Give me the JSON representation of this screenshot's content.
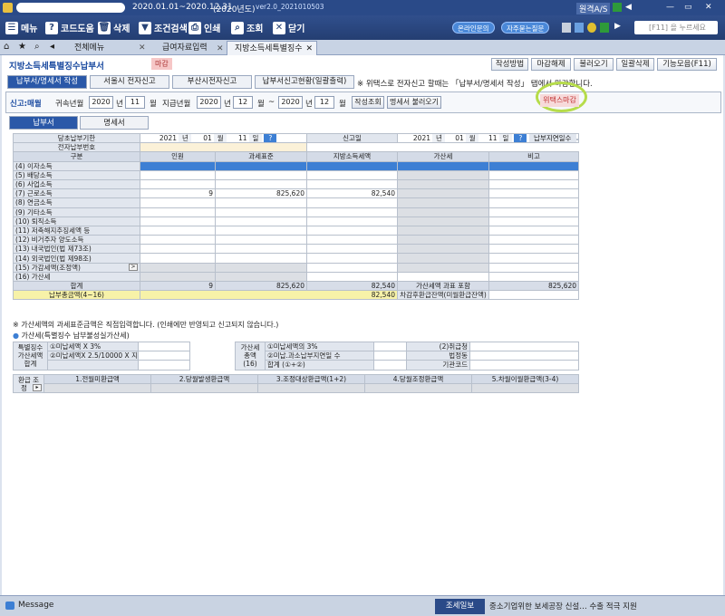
{
  "titlebar": {
    "period": "2020.01.01~2020.12.31",
    "year": "(2020년도)",
    "version": "ver2.0_2021010503",
    "right": "원격A/S"
  },
  "toolbar": {
    "menu": "메뉴",
    "code": "코드도움",
    "delete": "삭제",
    "filter": "조건검색",
    "print": "인쇄",
    "query": "조회",
    "close": "닫기",
    "online": "온라인문의",
    "faq": "자주묻는질문",
    "search_placeholder": "[F11] 을 누르세요"
  },
  "tabs": {
    "t1": "전체메뉴",
    "t2": "급여자료입력",
    "t3": "지방소득세특별징수"
  },
  "page": {
    "title": "지방소득세특별징수납부서",
    "badge": "마감",
    "buttons": [
      "작성방법",
      "마감해제",
      "불러오기",
      "일괄삭제",
      "기능모음(F11)"
    ],
    "subtabs": [
      "납부서/명세서 작성",
      "서울시 전자신고",
      "부산시전자신고",
      "납부서신고현황(일괄출력)"
    ],
    "note": "※ 위택스로 전자신고 할때는 「납부서/명세서 작성」 탭에서 마감합니다.",
    "wetax_magam": "위택스마감"
  },
  "filter": {
    "type_label": "신고:매월",
    "attr_label": "귀속년월",
    "attr_year": "2020",
    "attr_month": "11",
    "year_unit": "년",
    "month_unit": "월",
    "pay_label": "지급년월",
    "pay_from_year": "2020",
    "pay_from_month": "12",
    "pay_to_year": "2020",
    "pay_to_month": "12",
    "tilde": "~",
    "btn1": "작성조회",
    "btn2": "명세서 불러오기"
  },
  "btabs": [
    "납부서",
    "명세서"
  ],
  "form": {
    "due_label": "당초납부기한",
    "due_y": "2021",
    "due_m": "01",
    "due_d": "11",
    "y": "년",
    "m": "월",
    "d": "일",
    "report_label": "신고일",
    "rep_y": "2021",
    "rep_m": "01",
    "rep_d": "11",
    "delay_label": "납부지연일수",
    "delay_unit": "일",
    "efile_label": "전자납부번호",
    "headers": [
      "구분",
      "인원",
      "과세표준",
      "지방소득세액",
      "가산세",
      "비고"
    ],
    "rows": [
      {
        "name": "(4) 이자소득",
        "people": "",
        "base": "",
        "tax": ""
      },
      {
        "name": "(5) 배당소득",
        "people": "",
        "base": "",
        "tax": ""
      },
      {
        "name": "(6) 사업소득",
        "people": "",
        "base": "",
        "tax": ""
      },
      {
        "name": "(7) 근로소득",
        "people": "9",
        "base": "825,620",
        "tax": "82,540"
      },
      {
        "name": "(8) 연금소득",
        "people": "",
        "base": "",
        "tax": ""
      },
      {
        "name": "(9) 기타소득",
        "people": "",
        "base": "",
        "tax": ""
      },
      {
        "name": "(10) 퇴직소득",
        "people": "",
        "base": "",
        "tax": ""
      },
      {
        "name": "(11) 저축해지추징세액 등",
        "people": "",
        "base": "",
        "tax": ""
      },
      {
        "name": "(12) 비거주자 양도소득",
        "people": "",
        "base": "",
        "tax": ""
      },
      {
        "name": "(13) 내국법인(법 제73조)",
        "people": "",
        "base": "",
        "tax": ""
      },
      {
        "name": "(14) 외국법인(법 제98조)",
        "people": "",
        "base": "",
        "tax": ""
      },
      {
        "name": "(15) 가감세액(조정액)",
        "people": "",
        "base": "",
        "tax": ""
      },
      {
        "name": "(16) 가산세",
        "people": "",
        "base": "",
        "tax": ""
      }
    ],
    "total_label": "합계",
    "total_people": "9",
    "total_base": "825,620",
    "total_tax": "82,540",
    "total_add_label": "가산세액 과표 포함",
    "total_add": "825,620",
    "pay_total_label": "납부총금액(4~16)",
    "pay_total": "82,540",
    "refund_label": "차감후환급잔액(미월환급잔액)"
  },
  "msg1": "※ 가산세액의 과세표준금액은 직접입력합니다. (인쇄에만 반영되고 신고되지 않습니다.)",
  "msg2": "가산세(특별징수 납부불성실가산세)",
  "penalty": {
    "c1": "특별징수",
    "c2": "가산세액",
    "c3": "합계",
    "r1": "①미납세액 X 3%",
    "r2": "②미납세액X 2.5/10000 X 지연일",
    "m1": "가산세",
    "m2": "총액(16)",
    "s1": "①미납세액의 3%",
    "s2": "②미납.과소납부지연일 수",
    "s3": "합계 (①+②)",
    "e1": "(2)취급청",
    "e2": "법정동",
    "e3": "기관코드"
  },
  "refund": {
    "label": "환급 조정",
    "cols": [
      "1.전월미환급액",
      "2.당월발생환급액",
      "3.조정대상환급액(1+2)",
      "4.당월조정환급액",
      "5.차월이월환급액(3-4)"
    ]
  },
  "bottom": {
    "message": "Message",
    "news_label": "조세일보",
    "news": "중소기업위한 보세공장 신설… 수출 적극 지원"
  }
}
